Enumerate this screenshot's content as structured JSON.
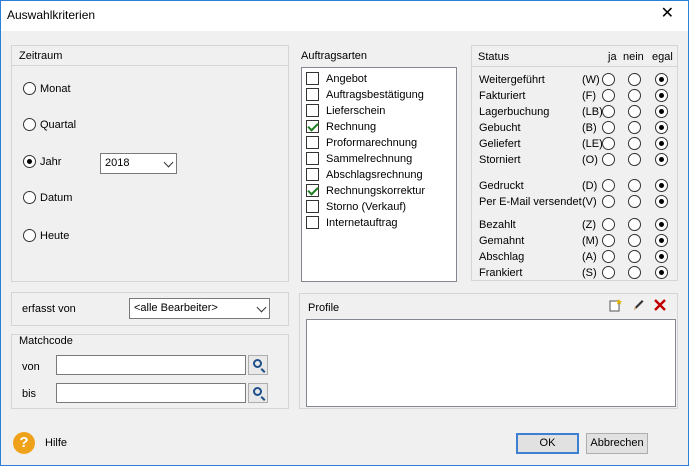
{
  "window": {
    "title": "Auswahlkriterien"
  },
  "zeitraum": {
    "header": "Zeitraum",
    "options": [
      "Monat",
      "Quartal",
      "Jahr",
      "Datum",
      "Heute"
    ],
    "selected": "Jahr",
    "year_value": "2018"
  },
  "auftragsarten": {
    "header": "Auftragsarten",
    "items": [
      {
        "label": "Angebot",
        "checked": false
      },
      {
        "label": "Auftragsbestätigung",
        "checked": false
      },
      {
        "label": "Lieferschein",
        "checked": false
      },
      {
        "label": "Rechnung",
        "checked": true
      },
      {
        "label": "Proformarechnung",
        "checked": false
      },
      {
        "label": "Sammelrechnung",
        "checked": false
      },
      {
        "label": "Abschlagsrechnung",
        "checked": false
      },
      {
        "label": "Rechnungskorrektur",
        "checked": true
      },
      {
        "label": "Storno (Verkauf)",
        "checked": false
      },
      {
        "label": "Internetauftrag",
        "checked": false
      }
    ]
  },
  "status": {
    "header": "Status",
    "col_ja": "ja",
    "col_nein": "nein",
    "col_egal": "egal",
    "rows": [
      {
        "label": "Weitergeführt",
        "key": "(W)",
        "value": "egal"
      },
      {
        "label": "Fakturiert",
        "key": "(F)",
        "value": "egal"
      },
      {
        "label": "Lagerbuchung",
        "key": "(LB)",
        "value": "egal"
      },
      {
        "label": "Gebucht",
        "key": "(B)",
        "value": "egal"
      },
      {
        "label": "Geliefert",
        "key": "(LE)",
        "value": "egal"
      },
      {
        "label": "Storniert",
        "key": "(O)",
        "value": "egal"
      },
      {
        "label": "Gedruckt",
        "key": "(D)",
        "value": "egal"
      },
      {
        "label": "Per E-Mail versendet",
        "key": "(V)",
        "value": "egal"
      },
      {
        "label": "Bezahlt",
        "key": "(Z)",
        "value": "egal"
      },
      {
        "label": "Gemahnt",
        "key": "(M)",
        "value": "egal"
      },
      {
        "label": "Abschlag",
        "key": "(A)",
        "value": "egal"
      },
      {
        "label": "Frankiert",
        "key": "(S)",
        "value": "egal"
      }
    ]
  },
  "erfasst": {
    "label": "erfasst von",
    "value": "<alle Bearbeiter>"
  },
  "matchcode": {
    "header": "Matchcode",
    "von_label": "von",
    "von_value": "",
    "bis_label": "bis",
    "bis_value": ""
  },
  "profile": {
    "header": "Profile",
    "icons": [
      "new-icon",
      "edit-icon",
      "delete-icon"
    ]
  },
  "footer": {
    "help_label": "Hilfe",
    "ok_label": "OK",
    "cancel_label": "Abbrechen"
  },
  "colors": {
    "accent": "#3c7fd3",
    "check": "#1e7b1e",
    "help": "#f0a11a",
    "delete": "#c00000"
  }
}
